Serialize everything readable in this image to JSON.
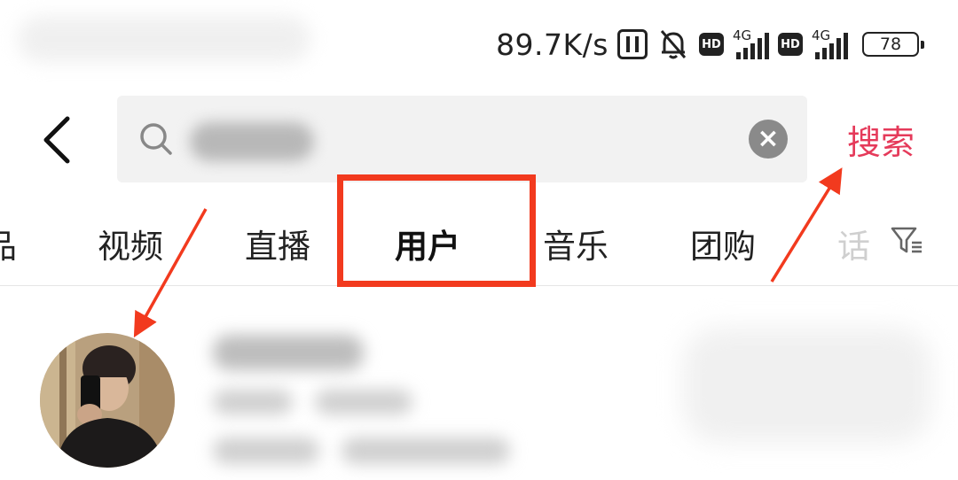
{
  "status_bar": {
    "net_speed": "89.7K/s",
    "signal1_label": "4G",
    "signal2_label": "4G",
    "hd1": "HD",
    "hd2": "HD",
    "battery": "78"
  },
  "search": {
    "query": "",
    "button_label": "搜索"
  },
  "tabs": [
    {
      "label": "品"
    },
    {
      "label": "视频"
    },
    {
      "label": "直播"
    },
    {
      "label": "用户"
    },
    {
      "label": "音乐"
    },
    {
      "label": "团购"
    },
    {
      "label": "话"
    }
  ],
  "active_tab_index": 3,
  "icons": {
    "back": "back-arrow-icon",
    "search": "search-icon",
    "clear": "clear-icon",
    "filter": "filter-icon",
    "bell_off": "bell-off-icon",
    "nfc": "nfc-icon"
  },
  "colors": {
    "accent": "#e53a5a",
    "highlight": "#f23a1e",
    "annotation_arrow": "#f23a1e"
  }
}
